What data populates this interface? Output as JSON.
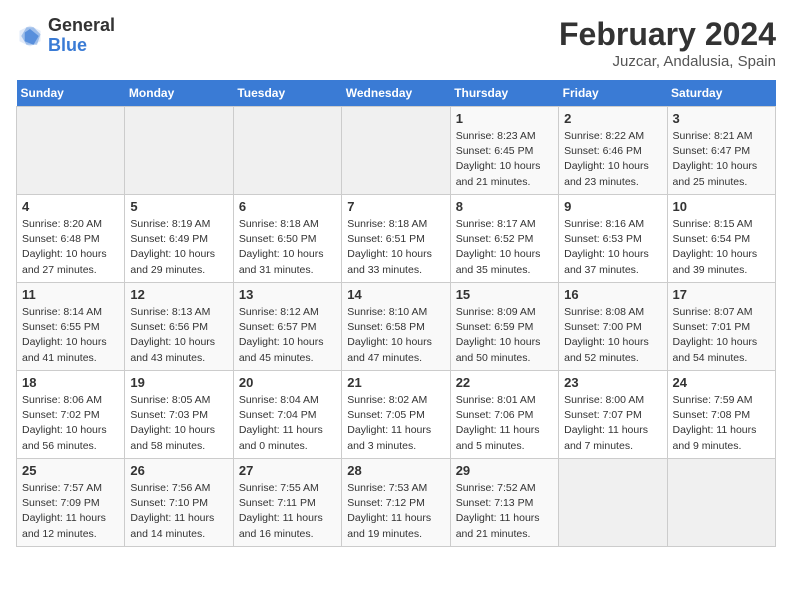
{
  "header": {
    "logo_general": "General",
    "logo_blue": "Blue",
    "month_title": "February 2024",
    "location": "Juzcar, Andalusia, Spain"
  },
  "weekdays": [
    "Sunday",
    "Monday",
    "Tuesday",
    "Wednesday",
    "Thursday",
    "Friday",
    "Saturday"
  ],
  "weeks": [
    [
      {
        "day": "",
        "info": ""
      },
      {
        "day": "",
        "info": ""
      },
      {
        "day": "",
        "info": ""
      },
      {
        "day": "",
        "info": ""
      },
      {
        "day": "1",
        "info": "Sunrise: 8:23 AM\nSunset: 6:45 PM\nDaylight: 10 hours\nand 21 minutes."
      },
      {
        "day": "2",
        "info": "Sunrise: 8:22 AM\nSunset: 6:46 PM\nDaylight: 10 hours\nand 23 minutes."
      },
      {
        "day": "3",
        "info": "Sunrise: 8:21 AM\nSunset: 6:47 PM\nDaylight: 10 hours\nand 25 minutes."
      }
    ],
    [
      {
        "day": "4",
        "info": "Sunrise: 8:20 AM\nSunset: 6:48 PM\nDaylight: 10 hours\nand 27 minutes."
      },
      {
        "day": "5",
        "info": "Sunrise: 8:19 AM\nSunset: 6:49 PM\nDaylight: 10 hours\nand 29 minutes."
      },
      {
        "day": "6",
        "info": "Sunrise: 8:18 AM\nSunset: 6:50 PM\nDaylight: 10 hours\nand 31 minutes."
      },
      {
        "day": "7",
        "info": "Sunrise: 8:18 AM\nSunset: 6:51 PM\nDaylight: 10 hours\nand 33 minutes."
      },
      {
        "day": "8",
        "info": "Sunrise: 8:17 AM\nSunset: 6:52 PM\nDaylight: 10 hours\nand 35 minutes."
      },
      {
        "day": "9",
        "info": "Sunrise: 8:16 AM\nSunset: 6:53 PM\nDaylight: 10 hours\nand 37 minutes."
      },
      {
        "day": "10",
        "info": "Sunrise: 8:15 AM\nSunset: 6:54 PM\nDaylight: 10 hours\nand 39 minutes."
      }
    ],
    [
      {
        "day": "11",
        "info": "Sunrise: 8:14 AM\nSunset: 6:55 PM\nDaylight: 10 hours\nand 41 minutes."
      },
      {
        "day": "12",
        "info": "Sunrise: 8:13 AM\nSunset: 6:56 PM\nDaylight: 10 hours\nand 43 minutes."
      },
      {
        "day": "13",
        "info": "Sunrise: 8:12 AM\nSunset: 6:57 PM\nDaylight: 10 hours\nand 45 minutes."
      },
      {
        "day": "14",
        "info": "Sunrise: 8:10 AM\nSunset: 6:58 PM\nDaylight: 10 hours\nand 47 minutes."
      },
      {
        "day": "15",
        "info": "Sunrise: 8:09 AM\nSunset: 6:59 PM\nDaylight: 10 hours\nand 50 minutes."
      },
      {
        "day": "16",
        "info": "Sunrise: 8:08 AM\nSunset: 7:00 PM\nDaylight: 10 hours\nand 52 minutes."
      },
      {
        "day": "17",
        "info": "Sunrise: 8:07 AM\nSunset: 7:01 PM\nDaylight: 10 hours\nand 54 minutes."
      }
    ],
    [
      {
        "day": "18",
        "info": "Sunrise: 8:06 AM\nSunset: 7:02 PM\nDaylight: 10 hours\nand 56 minutes."
      },
      {
        "day": "19",
        "info": "Sunrise: 8:05 AM\nSunset: 7:03 PM\nDaylight: 10 hours\nand 58 minutes."
      },
      {
        "day": "20",
        "info": "Sunrise: 8:04 AM\nSunset: 7:04 PM\nDaylight: 11 hours\nand 0 minutes."
      },
      {
        "day": "21",
        "info": "Sunrise: 8:02 AM\nSunset: 7:05 PM\nDaylight: 11 hours\nand 3 minutes."
      },
      {
        "day": "22",
        "info": "Sunrise: 8:01 AM\nSunset: 7:06 PM\nDaylight: 11 hours\nand 5 minutes."
      },
      {
        "day": "23",
        "info": "Sunrise: 8:00 AM\nSunset: 7:07 PM\nDaylight: 11 hours\nand 7 minutes."
      },
      {
        "day": "24",
        "info": "Sunrise: 7:59 AM\nSunset: 7:08 PM\nDaylight: 11 hours\nand 9 minutes."
      }
    ],
    [
      {
        "day": "25",
        "info": "Sunrise: 7:57 AM\nSunset: 7:09 PM\nDaylight: 11 hours\nand 12 minutes."
      },
      {
        "day": "26",
        "info": "Sunrise: 7:56 AM\nSunset: 7:10 PM\nDaylight: 11 hours\nand 14 minutes."
      },
      {
        "day": "27",
        "info": "Sunrise: 7:55 AM\nSunset: 7:11 PM\nDaylight: 11 hours\nand 16 minutes."
      },
      {
        "day": "28",
        "info": "Sunrise: 7:53 AM\nSunset: 7:12 PM\nDaylight: 11 hours\nand 19 minutes."
      },
      {
        "day": "29",
        "info": "Sunrise: 7:52 AM\nSunset: 7:13 PM\nDaylight: 11 hours\nand 21 minutes."
      },
      {
        "day": "",
        "info": ""
      },
      {
        "day": "",
        "info": ""
      }
    ]
  ]
}
